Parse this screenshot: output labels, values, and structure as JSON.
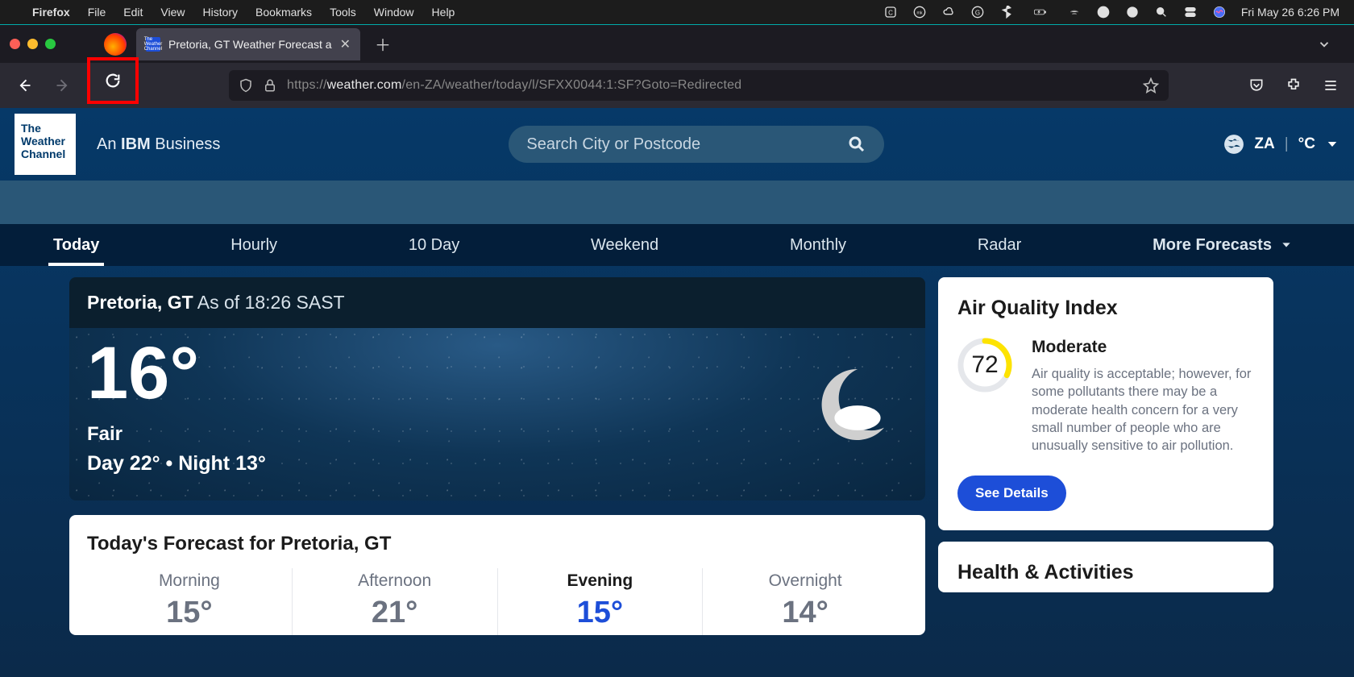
{
  "menubar": {
    "app": "Firefox",
    "items": [
      "File",
      "Edit",
      "View",
      "History",
      "Bookmarks",
      "Tools",
      "Window",
      "Help"
    ],
    "datetime": "Fri May 26  6:26 PM"
  },
  "browser": {
    "tab_title": "Pretoria, GT Weather Forecast a",
    "url_prefix": "https://",
    "url_host": "weather.com",
    "url_path": "/en-ZA/weather/today/l/SFXX0044:1:SF?Goto=Redirected"
  },
  "site_header": {
    "logo_lines": [
      "The",
      "Weather",
      "Channel"
    ],
    "tagline_prefix": "An ",
    "tagline_bold": "IBM",
    "tagline_suffix": " Business",
    "search_placeholder": "Search City or Postcode",
    "region_code": "ZA",
    "unit": "°C"
  },
  "site_nav": {
    "items": [
      "Today",
      "Hourly",
      "10 Day",
      "Weekend",
      "Monthly",
      "Radar"
    ],
    "more": "More Forecasts"
  },
  "hero": {
    "location": "Pretoria, GT",
    "as_of": "As of 18:26 SAST",
    "temp": "16°",
    "condition": "Fair",
    "dn": "Day 22° • Night 13°"
  },
  "forecast_card": {
    "title": "Today's Forecast for Pretoria, GT",
    "cells": [
      {
        "label": "Morning",
        "temp": "15°",
        "current": false
      },
      {
        "label": "Afternoon",
        "temp": "21°",
        "current": false
      },
      {
        "label": "Evening",
        "temp": "15°",
        "current": true
      },
      {
        "label": "Overnight",
        "temp": "14°",
        "current": false
      }
    ]
  },
  "aqi": {
    "title": "Air Quality Index",
    "value": "72",
    "level": "Moderate",
    "desc": "Air quality is acceptable; however, for some pollutants there may be a moderate health concern for a very small number of people who are unusually sensitive to air pollution.",
    "button": "See Details"
  },
  "health_card": {
    "title": "Health & Activities"
  }
}
